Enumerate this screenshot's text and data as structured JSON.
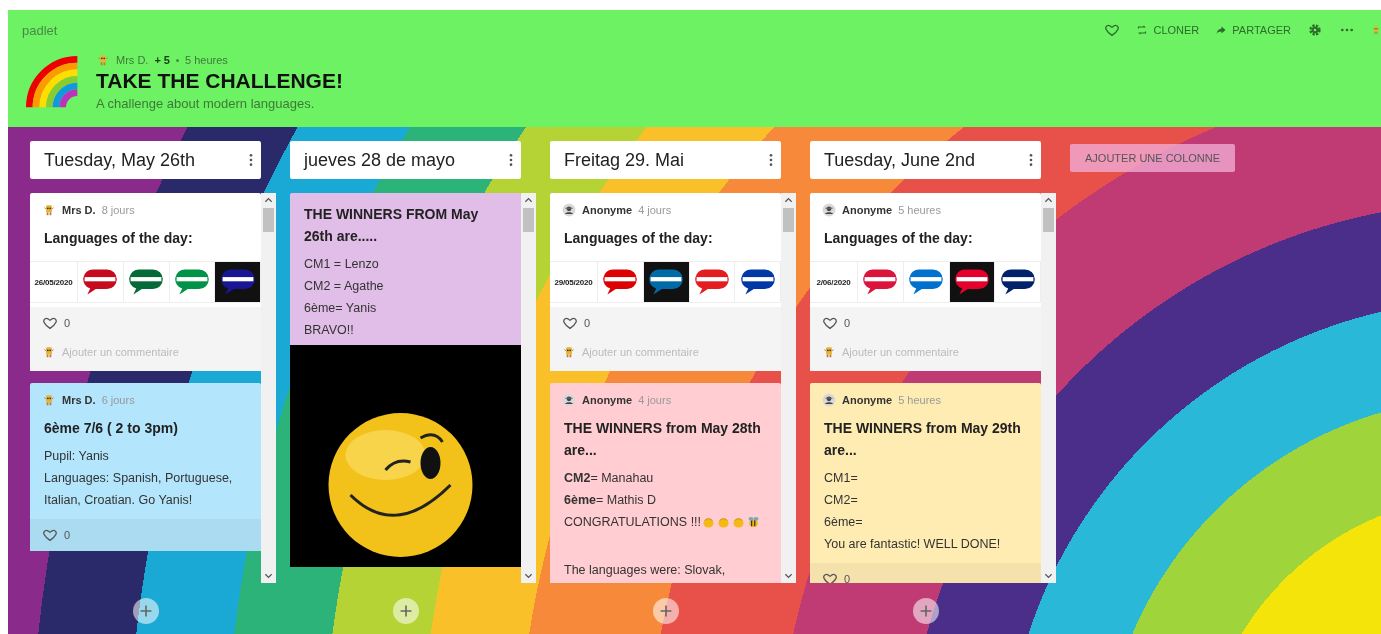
{
  "header": {
    "brand": "padlet",
    "author": "Mrs D.",
    "contributors": "+ 5",
    "updated": "5 heures",
    "title": "TAKE THE CHALLENGE!",
    "subtitle": "A challenge about modern languages.",
    "toolbar": [
      {
        "kind": "heart"
      },
      {
        "kind": "clone",
        "label": "CLONER"
      },
      {
        "kind": "share",
        "label": "PARTAGER"
      },
      {
        "kind": "settings"
      },
      {
        "kind": "more"
      },
      {
        "kind": "avatar"
      }
    ]
  },
  "columns": [
    {
      "title": "Tuesday, May 26th",
      "posts": [
        {
          "author": "Mrs D.",
          "anonymous": false,
          "time": "8 jours",
          "color": "#ffffff",
          "title": "Languages of the day:",
          "images": [
            {
              "kind": "date",
              "text": "26/05/2020"
            },
            {
              "kind": "flag",
              "color": "#c60b1e",
              "dark": false
            },
            {
              "kind": "flag",
              "color": "#046a38",
              "dark": false
            },
            {
              "kind": "flag",
              "color": "#009246",
              "dark": false
            },
            {
              "kind": "flag",
              "color": "#171796",
              "dark": true
            }
          ],
          "likes": "0",
          "comment_placeholder": "Ajouter un commentaire"
        },
        {
          "author": "Mrs D.",
          "anonymous": false,
          "time": "6 jours",
          "color": "#b3e5fc",
          "title": "6ème 7/6 ( 2 to 3pm)",
          "paragraphs": [
            [
              "Pupil: Yanis",
              "Languages: Spanish, Portuguese, Italian, Croatian. Go Yanis!"
            ]
          ],
          "likes": "0"
        }
      ]
    },
    {
      "title": "jueves 28 de mayo",
      "posts": [
        {
          "color": "#e1bee7",
          "title": "THE WINNERS FROM May 26th are.....",
          "paragraphs": [
            [
              "CM1 = Lenzo",
              "CM2 = Agathe",
              "6ème= Yanis",
              "BRAVO!!"
            ]
          ],
          "photo": true
        }
      ]
    },
    {
      "title": "Freitag 29. Mai",
      "posts": [
        {
          "author": "Anonyme",
          "anonymous": true,
          "time": "4 jours",
          "color": "#ffffff",
          "title": "Languages of the day:",
          "images": [
            {
              "kind": "date",
              "text": "29/05/2020"
            },
            {
              "kind": "flag",
              "color": "#dd0000",
              "dark": false
            },
            {
              "kind": "flag",
              "color": "#006aa7",
              "dark": true
            },
            {
              "kind": "flag",
              "color": "#e41e20",
              "dark": false
            },
            {
              "kind": "flag",
              "color": "#0039a6",
              "dark": false
            }
          ],
          "likes": "0",
          "comment_placeholder": "Ajouter un commentaire"
        },
        {
          "author": "Anonyme",
          "anonymous": true,
          "time": "4 jours",
          "color": "#ffcdd2",
          "title": "THE WINNERS from May 28th are...",
          "paragraphs": [
            [
              "**CM2**= Manahau",
              "**6ème**= Mathis D",
              "CONGRATULATIONS !!!"
            ],
            [
              "The languages were: Slovak,"
            ]
          ],
          "emojis": [
            {
              "kind": "clap"
            },
            {
              "kind": "clap"
            },
            {
              "kind": "clap"
            },
            {
              "kind": "bee"
            }
          ]
        }
      ]
    },
    {
      "title": "Tuesday, June 2nd",
      "posts": [
        {
          "author": "Anonyme",
          "anonymous": true,
          "time": "5 heures",
          "color": "#ffffff",
          "title": "Languages of the day:",
          "images": [
            {
              "kind": "date",
              "text": "2/06/2020"
            },
            {
              "kind": "flag",
              "color": "#dc143c",
              "dark": false
            },
            {
              "kind": "flag",
              "color": "#0072ce",
              "dark": false
            },
            {
              "kind": "flag",
              "color": "#e4002b",
              "dark": true
            },
            {
              "kind": "flag",
              "color": "#012169",
              "dark": false
            }
          ],
          "likes": "0",
          "comment_placeholder": "Ajouter un commentaire"
        },
        {
          "author": "Anonyme",
          "anonymous": true,
          "time": "5 heures",
          "color": "#ffecb3",
          "title": "THE WINNERS from May 29th are...",
          "paragraphs": [
            [
              "CM1=",
              "CM2=",
              "6ème=",
              "You are fantastic! WELL DONE!"
            ]
          ],
          "likes": "0"
        }
      ]
    }
  ],
  "add_column": "AJOUTER UNE COLONNE"
}
